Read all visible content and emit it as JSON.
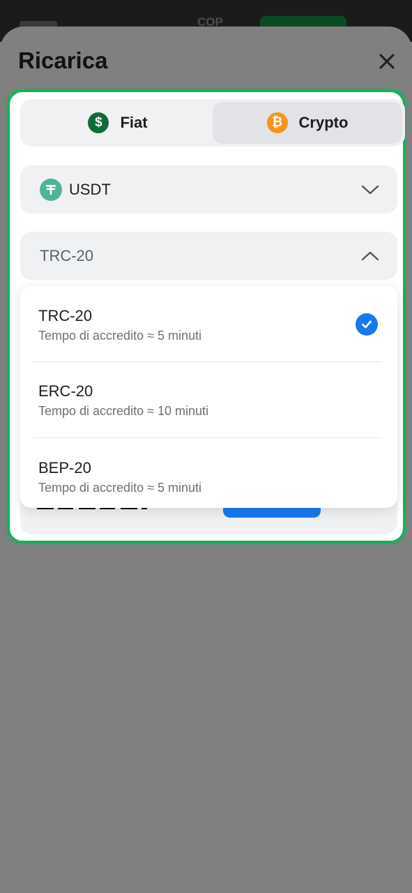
{
  "background": {
    "currency": "COP"
  },
  "sheet": {
    "title": "Ricarica"
  },
  "tabs": [
    {
      "label": "Fiat",
      "icon": "dollar-coin-icon",
      "active": false
    },
    {
      "label": "Crypto",
      "icon": "bitcoin-coin-icon",
      "active": true
    }
  ],
  "asset_select": {
    "value": "USDT",
    "icon": "tether-icon"
  },
  "network_select": {
    "value": "TRC-20",
    "expanded": true
  },
  "network_options": [
    {
      "name": "TRC-20",
      "detail": "Tempo di accredito ≈ 5 minuti",
      "selected": true
    },
    {
      "name": "ERC-20",
      "detail": "Tempo di accredito ≈ 10 minuti",
      "selected": false
    },
    {
      "name": "BEP-20",
      "detail": "Tempo di accredito ≈ 5 minuti",
      "selected": false
    }
  ],
  "colors": {
    "accent_green": "#18b05a",
    "selected_blue": "#1779f2",
    "fiat_coin": "#0f6b37",
    "crypto_coin": "#f7931a",
    "tether": "#4fb497"
  }
}
